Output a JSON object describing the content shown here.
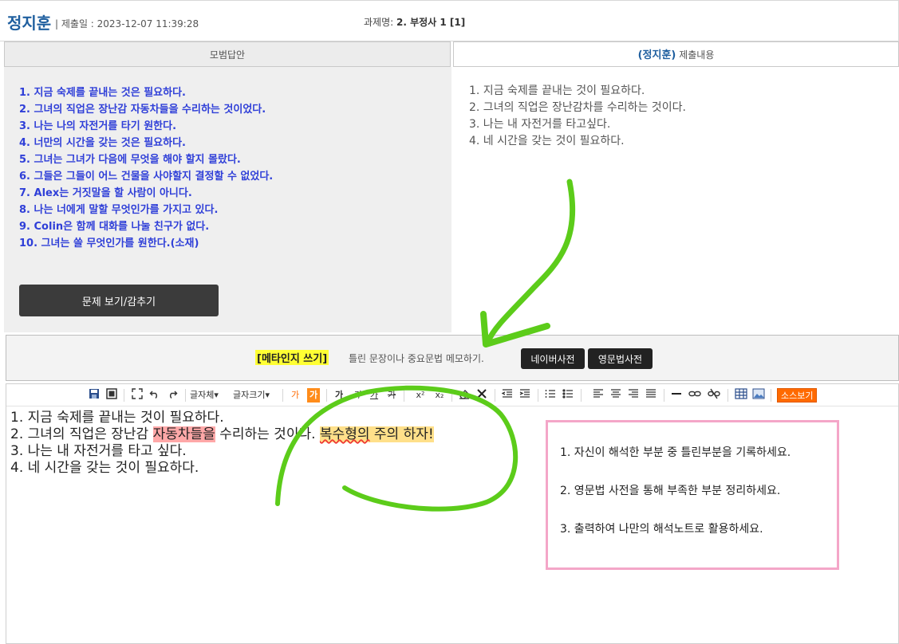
{
  "header": {
    "student_name": "정지훈",
    "submit_date": "| 제출일 : 2023-12-07 11:39:28",
    "task_label": "과제명:",
    "task_value": "2. 부정사 1 [1]"
  },
  "tabs": {
    "model": "모범답안",
    "submit_who": "(정지훈)",
    "submit_suffix": "제출내용"
  },
  "model_answers": [
    "1. 지금 숙제를 끝내는 것은 필요하다.",
    "2. 그녀의 직업은 장난감 자동차들을 수리하는 것이었다.",
    "3. 나는 나의 자전거를 타기 원한다.",
    "4. 너만의 시간을 갖는 것은 필요하다.",
    "5. 그녀는 그녀가 다음에 무엇을 해야 할지 몰랐다.",
    "6. 그들은 그들이 어느 건물을 사야할지 결정할 수 없었다.",
    "7. Alex는 거짓말을 할 사람이 아니다.",
    "8. 나는 너에게 말할 무엇인가를 가지고 있다.",
    "9. Colin은 함께 대화를 나눌 친구가 없다.",
    "10. 그녀는 쓸 무엇인가를 원한다.(소재)"
  ],
  "toggle_button": "문제 보기/감추기",
  "submitted_answers": [
    "1. 지금 숙제를 끝내는 것이 필요하다.",
    "2. 그녀의 직업은 장난감차를 수리하는 것이다.",
    "3. 나는 내 자전거를 타고싶다.",
    "4. 네 시간을 갖는 것이 필요하다."
  ],
  "meta": {
    "label": "[메타인지 쓰기]",
    "description": "틀린 문장이나 중요문법 메모하기.",
    "naver_button": "네이버사전",
    "grammar_button": "영문법사전"
  },
  "toolbar": {
    "font_family": "글자체",
    "font_size": "글자크기",
    "text_color": "가",
    "bg_color": "가",
    "bold": "가",
    "italic": "가",
    "underline": "가",
    "strike": "가",
    "superscript": "x²",
    "subscript": "x₂",
    "source_view": "소스보기"
  },
  "editor": {
    "line1": "1. 지금 숙제를 끝내는 것이 필요하다.",
    "line2_a": "2. 그녀의 직업은 장난감 ",
    "line2_hl": "자동차들을",
    "line2_b": " 수리하는 것이다.   ",
    "line2_note_a": "복수형의",
    "line2_note_b": " 주의 하자!",
    "line3": "3. 나는 내 자전거를 타고 싶다.",
    "line4": "4. 네 시간을 갖는 것이 필요하다."
  },
  "tips": [
    "1. 자신이 해석한 부분 중 틀린부분을 기록하세요.",
    "2. 영문법 사전을 통해 부족한 부분 정리하세요.",
    "3. 출력하여 나만의 해석노트로 활용하세요."
  ],
  "colors": {
    "name_blue": "#1f5f9f",
    "model_text": "#2f3fd8",
    "highlight_yellow": "#ffff33",
    "source_orange": "#ff6a00",
    "tips_border": "#f4a6c8",
    "annotation_green": "#5ccc1a"
  }
}
